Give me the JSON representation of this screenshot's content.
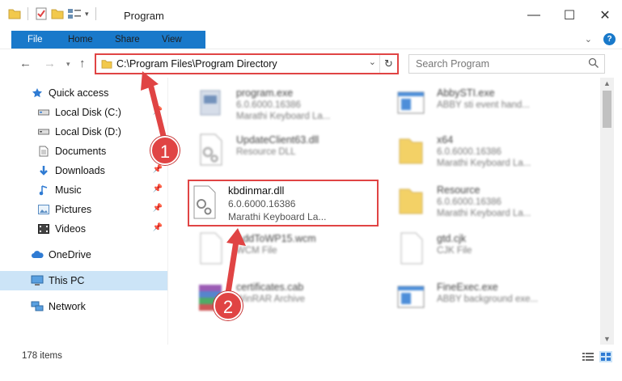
{
  "window": {
    "title": "Program",
    "minimize": "—",
    "maximize": "☐",
    "close": "✕"
  },
  "ribbon": {
    "tabs": [
      "File",
      "Home",
      "Share",
      "View"
    ],
    "expand": "⌄"
  },
  "nav": {
    "back": "←",
    "forward": "→",
    "up": "↑",
    "address": "C:\\Program Files\\Program Directory",
    "search_placeholder": "Search Program"
  },
  "sidebar": {
    "items": [
      {
        "label": "Quick access",
        "icon": "star-icon"
      },
      {
        "label": "Local Disk (C:)",
        "icon": "drive-icon"
      },
      {
        "label": "Local Disk (D:)",
        "icon": "drive-icon"
      },
      {
        "label": "Documents",
        "icon": "documents-icon"
      },
      {
        "label": "Downloads",
        "icon": "download-icon"
      },
      {
        "label": "Music",
        "icon": "music-icon"
      },
      {
        "label": "Pictures",
        "icon": "pictures-icon"
      },
      {
        "label": "Videos",
        "icon": "videos-icon"
      },
      {
        "label": "OneDrive",
        "icon": "cloud-icon"
      },
      {
        "label": "This PC",
        "icon": "computer-icon"
      },
      {
        "label": "Network",
        "icon": "network-icon"
      }
    ]
  },
  "files": [
    {
      "name": "program.exe",
      "line2": "6.0.6000.16386",
      "line3": "Marathi Keyboard La..."
    },
    {
      "name": "AbbySTI.exe",
      "line2": "ABBY sti event hand...",
      "line3": ""
    },
    {
      "name": "UpdateClient63.dll",
      "line2": "Resource DLL",
      "line3": ""
    },
    {
      "name": "x64",
      "line2": "6.0.6000.16386",
      "line3": "Marathi Keyboard La..."
    },
    {
      "name": "kbdinmar.dll",
      "line2": "6.0.6000.16386",
      "line3": "Marathi Keyboard La..."
    },
    {
      "name": "Resource",
      "line2": "6.0.6000.16386",
      "line3": "Marathi Keyboard La..."
    },
    {
      "name": "AddToWP15.wcm",
      "line2": "WCM File",
      "line3": ""
    },
    {
      "name": "gtd.cjk",
      "line2": "CJK File",
      "line3": ""
    },
    {
      "name": "certificates.cab",
      "line2": "WinRAR Archive",
      "line3": ""
    },
    {
      "name": "FineExec.exe",
      "line2": "ABBY background exe...",
      "line3": ""
    }
  ],
  "status": {
    "count": "178 items"
  },
  "callouts": [
    "1",
    "2"
  ],
  "colors": {
    "accent": "#1979ca",
    "highlight": "#e04444",
    "selected": "#cce4f7"
  }
}
